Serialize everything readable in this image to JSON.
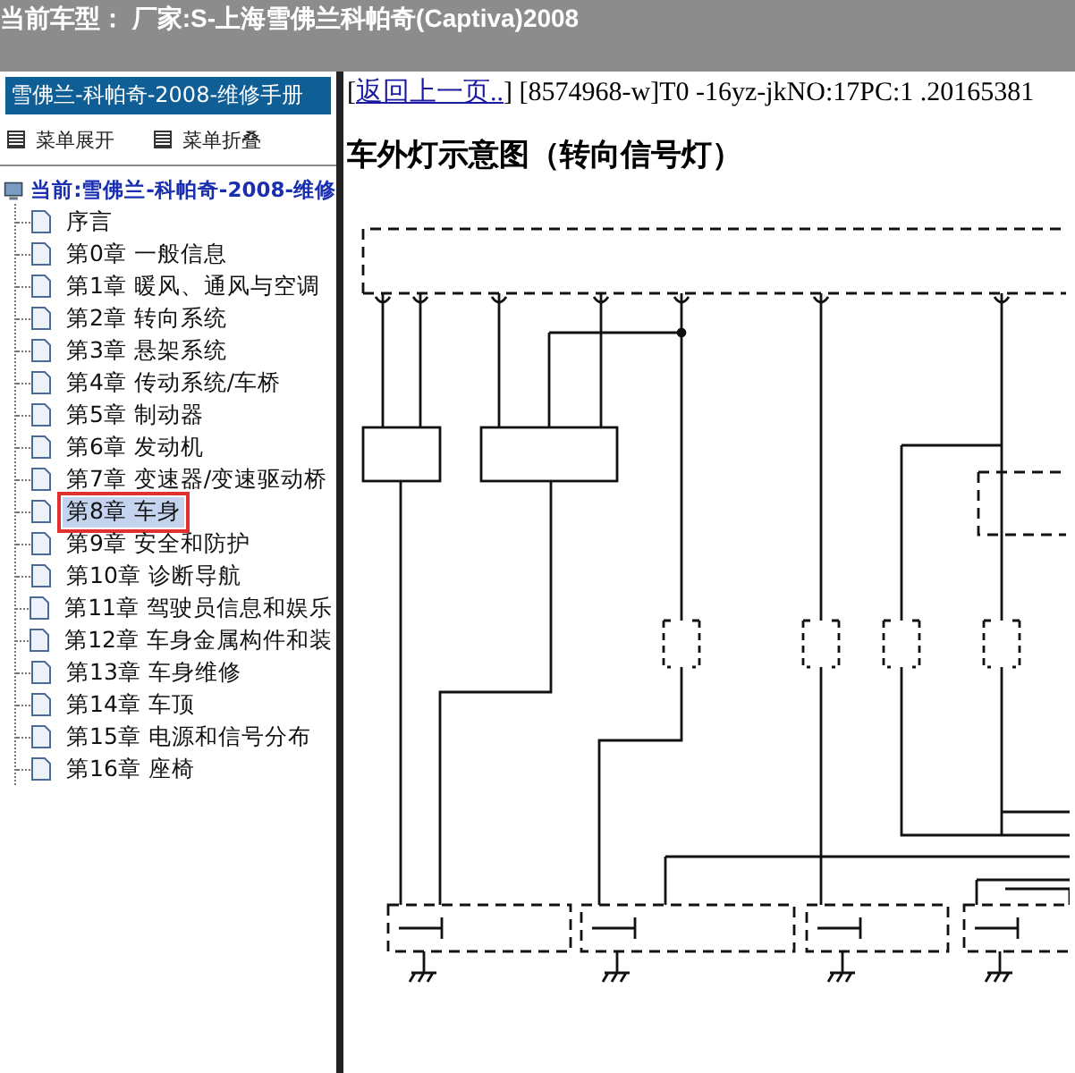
{
  "title_bar": {
    "text": "当前车型： 厂家:S-上海雪佛兰科帕奇(Captiva)2008"
  },
  "sidebar": {
    "header": "雪佛兰-科帕奇-2008-维修手册",
    "actions": [
      {
        "label": "菜单展开"
      },
      {
        "label": "菜单折叠"
      }
    ],
    "tree": {
      "label": "当前:雪佛兰-科帕奇-2008-维修",
      "children": [
        {
          "label": "序言",
          "selected": false
        },
        {
          "label": "第0章 一般信息",
          "selected": false
        },
        {
          "label": "第1章 暖风、通风与空调",
          "selected": false
        },
        {
          "label": "第2章 转向系统",
          "selected": false
        },
        {
          "label": "第3章 悬架系统",
          "selected": false
        },
        {
          "label": "第4章 传动系统/车桥",
          "selected": false
        },
        {
          "label": "第5章 制动器",
          "selected": false
        },
        {
          "label": "第6章 发动机",
          "selected": false
        },
        {
          "label": "第7章 变速器/变速驱动桥",
          "selected": false
        },
        {
          "label": "第8章 车身",
          "selected": true
        },
        {
          "label": "第9章 安全和防护",
          "selected": false
        },
        {
          "label": "第10章 诊断导航",
          "selected": false
        },
        {
          "label": "第11章 驾驶员信息和娱乐",
          "selected": false
        },
        {
          "label": "第12章 车身金属构件和装",
          "selected": false
        },
        {
          "label": "第13章 车身维修",
          "selected": false
        },
        {
          "label": "第14章 车顶",
          "selected": false
        },
        {
          "label": "第15章 电源和信号分布",
          "selected": false
        },
        {
          "label": "第16章 座椅",
          "selected": false
        }
      ]
    }
  },
  "content": {
    "bracket_open": "[",
    "back_link": "返回上一页..",
    "bracket_close": "]",
    "doc_code": "[8574968-w]T0 -16yz-jkNO:17PC:1 .20165381",
    "heading": "车外灯示意图（转向信号灯）"
  }
}
